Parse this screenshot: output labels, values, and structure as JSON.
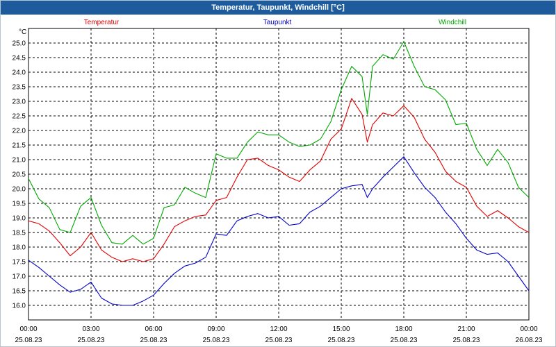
{
  "chart_data": {
    "type": "line",
    "title": "Temperatur, Taupunkt, Windchill [°C]",
    "xlabel": "",
    "ylabel": "°C",
    "ylim": [
      15.5,
      25.5
    ],
    "xlim": [
      "25.08.23 00:00",
      "26.08.23 00:00"
    ],
    "grid": true,
    "legend": "top",
    "y_ticks": [
      "16.0",
      "16.5",
      "17.0",
      "17.5",
      "18.0",
      "18.5",
      "19.0",
      "19.5",
      "20.0",
      "20.5",
      "21.0",
      "21.5",
      "22.0",
      "22.5",
      "23.0",
      "23.5",
      "24.0",
      "24.5",
      "25.0"
    ],
    "x_ticks": [
      {
        "time": "00:00",
        "date": "25.08.23"
      },
      {
        "time": "03:00",
        "date": "25.08.23"
      },
      {
        "time": "06:00",
        "date": "25.08.23"
      },
      {
        "time": "09:00",
        "date": "25.08.23"
      },
      {
        "time": "12:00",
        "date": "25.08.23"
      },
      {
        "time": "15:00",
        "date": "25.08.23"
      },
      {
        "time": "18:00",
        "date": "25.08.23"
      },
      {
        "time": "21:00",
        "date": "25.08.23"
      },
      {
        "time": "00:00",
        "date": "26.08.23"
      }
    ],
    "x": [
      "25.08.23 00:00",
      "25.08.23 00:30",
      "25.08.23 01:00",
      "25.08.23 01:30",
      "25.08.23 02:00",
      "25.08.23 02:30",
      "25.08.23 03:00",
      "25.08.23 03:30",
      "25.08.23 04:00",
      "25.08.23 04:30",
      "25.08.23 05:00",
      "25.08.23 05:30",
      "25.08.23 06:00",
      "25.08.23 06:30",
      "25.08.23 07:00",
      "25.08.23 07:30",
      "25.08.23 08:00",
      "25.08.23 08:30",
      "25.08.23 09:00",
      "25.08.23 09:30",
      "25.08.23 10:00",
      "25.08.23 10:30",
      "25.08.23 11:00",
      "25.08.23 11:30",
      "25.08.23 12:00",
      "25.08.23 12:30",
      "25.08.23 13:00",
      "25.08.23 13:30",
      "25.08.23 14:00",
      "25.08.23 14:30",
      "25.08.23 15:00",
      "25.08.23 15:30",
      "25.08.23 16:00",
      "25.08.23 16:15",
      "25.08.23 16:30",
      "25.08.23 17:00",
      "25.08.23 17:30",
      "25.08.23 18:00",
      "25.08.23 18:30",
      "25.08.23 19:00",
      "25.08.23 19:30",
      "25.08.23 20:00",
      "25.08.23 20:30",
      "25.08.23 21:00",
      "25.08.23 21:30",
      "25.08.23 22:00",
      "25.08.23 22:30",
      "25.08.23 23:00",
      "25.08.23 23:30",
      "26.08.23 00:00"
    ],
    "series": [
      {
        "name": "Temperatur",
        "color": "#e00000",
        "values": [
          18.9,
          18.8,
          18.55,
          18.15,
          17.7,
          18.0,
          18.5,
          17.9,
          17.65,
          17.5,
          17.6,
          17.5,
          17.6,
          18.1,
          18.7,
          18.9,
          19.05,
          19.1,
          19.6,
          19.7,
          20.4,
          21.0,
          21.05,
          20.8,
          20.65,
          20.4,
          20.25,
          20.65,
          20.95,
          21.7,
          22.05,
          23.1,
          22.55,
          21.6,
          22.2,
          22.6,
          22.5,
          22.85,
          22.45,
          21.7,
          21.25,
          20.6,
          20.25,
          20.05,
          19.4,
          19.05,
          19.25,
          19.0,
          18.7,
          18.5
        ]
      },
      {
        "name": "Taupunkt",
        "color": "#0000c8",
        "values": [
          17.55,
          17.3,
          17.0,
          16.7,
          16.45,
          16.55,
          16.8,
          16.25,
          16.05,
          16.0,
          16.0,
          16.15,
          16.35,
          16.75,
          17.1,
          17.35,
          17.45,
          17.65,
          18.45,
          18.4,
          18.9,
          19.05,
          19.15,
          19.0,
          19.05,
          18.75,
          18.8,
          19.2,
          19.4,
          19.7,
          20.0,
          20.1,
          20.15,
          19.7,
          20.0,
          20.4,
          20.75,
          21.1,
          20.55,
          20.05,
          19.7,
          19.2,
          18.8,
          18.3,
          17.9,
          17.75,
          17.8,
          17.5,
          17.0,
          16.5
        ]
      },
      {
        "name": "Windchill",
        "color": "#00a800",
        "values": [
          20.35,
          19.65,
          19.35,
          18.6,
          18.5,
          19.4,
          19.7,
          18.75,
          18.15,
          18.1,
          18.4,
          18.1,
          18.3,
          19.35,
          19.45,
          20.05,
          19.85,
          19.7,
          21.2,
          21.05,
          21.05,
          21.6,
          21.95,
          21.85,
          21.85,
          21.6,
          21.45,
          21.5,
          21.7,
          22.3,
          23.4,
          24.2,
          23.85,
          22.55,
          24.2,
          24.6,
          24.45,
          25.05,
          24.2,
          23.5,
          23.4,
          23.05,
          22.2,
          22.25,
          21.35,
          20.8,
          21.35,
          20.9,
          20.05,
          19.7
        ]
      }
    ]
  }
}
